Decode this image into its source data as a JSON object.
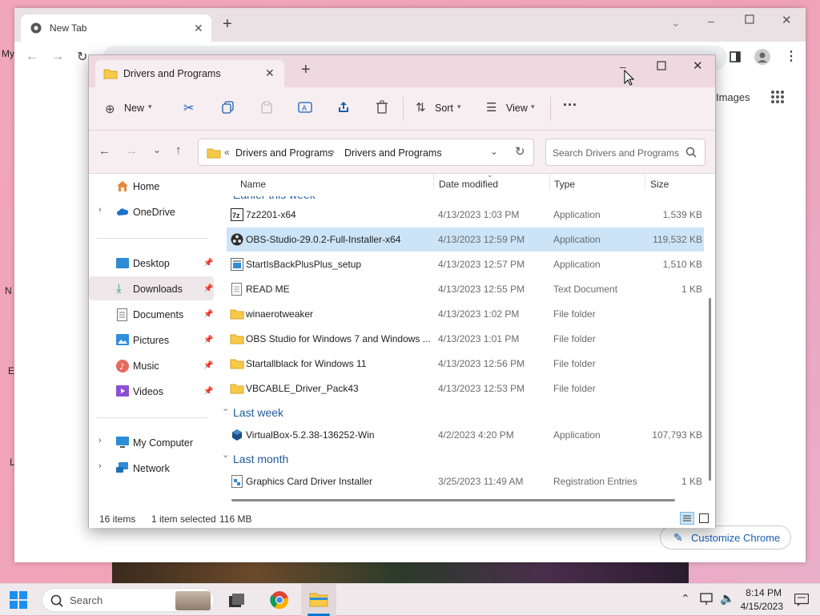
{
  "chrome": {
    "tab_title": "New Tab",
    "images_label": "Images",
    "customize_label": "Customize Chrome"
  },
  "desktop_labels": [
    "My",
    "N",
    "E",
    "L"
  ],
  "explorer": {
    "tab_title": "Drivers and Programs",
    "cmd": {
      "new": "New",
      "sort": "Sort",
      "view": "View"
    },
    "breadcrumb": {
      "sep": "«",
      "part1": "Drivers and Programs",
      "part2": "Drivers and Programs"
    },
    "search_placeholder": "Search Drivers and Programs",
    "nav": {
      "home": "Home",
      "onedrive": "OneDrive",
      "desktop": "Desktop",
      "downloads": "Downloads",
      "documents": "Documents",
      "pictures": "Pictures",
      "music": "Music",
      "videos": "Videos",
      "mycomputer": "My Computer",
      "network": "Network"
    },
    "columns": {
      "name": "Name",
      "date": "Date modified",
      "type": "Type",
      "size": "Size"
    },
    "groups": {
      "earlier": "Earlier this week",
      "lastweek": "Last week",
      "lastmonth": "Last month"
    },
    "rows": [
      {
        "name": "7z2201-x64",
        "date": "4/13/2023 1:03 PM",
        "type": "Application",
        "size": "1,539 KB",
        "icon": "7zip-icon"
      },
      {
        "name": "OBS-Studio-29.0.2-Full-Installer-x64",
        "date": "4/13/2023 12:59 PM",
        "type": "Application",
        "size": "119,532 KB",
        "icon": "obs-icon"
      },
      {
        "name": "StartIsBackPlusPlus_setup",
        "date": "4/13/2023 12:57 PM",
        "type": "Application",
        "size": "1,510 KB",
        "icon": "installer-icon"
      },
      {
        "name": "READ ME",
        "date": "4/13/2023 12:55 PM",
        "type": "Text Document",
        "size": "1 KB",
        "icon": "text-file-icon"
      },
      {
        "name": "winaerotweaker",
        "date": "4/13/2023 1:02 PM",
        "type": "File folder",
        "size": "",
        "icon": "folder-icon"
      },
      {
        "name": "OBS Studio for Windows 7 and Windows ...",
        "date": "4/13/2023 1:01 PM",
        "type": "File folder",
        "size": "",
        "icon": "folder-icon"
      },
      {
        "name": "Startallblack for Windows 11",
        "date": "4/13/2023 12:56 PM",
        "type": "File folder",
        "size": "",
        "icon": "folder-icon"
      },
      {
        "name": "VBCABLE_Driver_Pack43",
        "date": "4/13/2023 12:53 PM",
        "type": "File folder",
        "size": "",
        "icon": "folder-icon"
      },
      {
        "name": "VirtualBox-5.2.38-136252-Win",
        "date": "4/2/2023 4:20 PM",
        "type": "Application",
        "size": "107,793 KB",
        "icon": "virtualbox-icon"
      },
      {
        "name": "Graphics Card Driver Installer",
        "date": "3/25/2023 11:49 AM",
        "type": "Registration Entries",
        "size": "1 KB",
        "icon": "registry-icon"
      }
    ],
    "status": {
      "items": "16 items",
      "selected": "1 item selected",
      "size": "116 MB"
    }
  },
  "taskbar": {
    "search_label": "Search",
    "time": "8:14 PM",
    "date": "4/15/2023"
  },
  "colors": {
    "accent": "#0078d4",
    "selection": "#cce4f7",
    "folder": "#f7c948"
  }
}
